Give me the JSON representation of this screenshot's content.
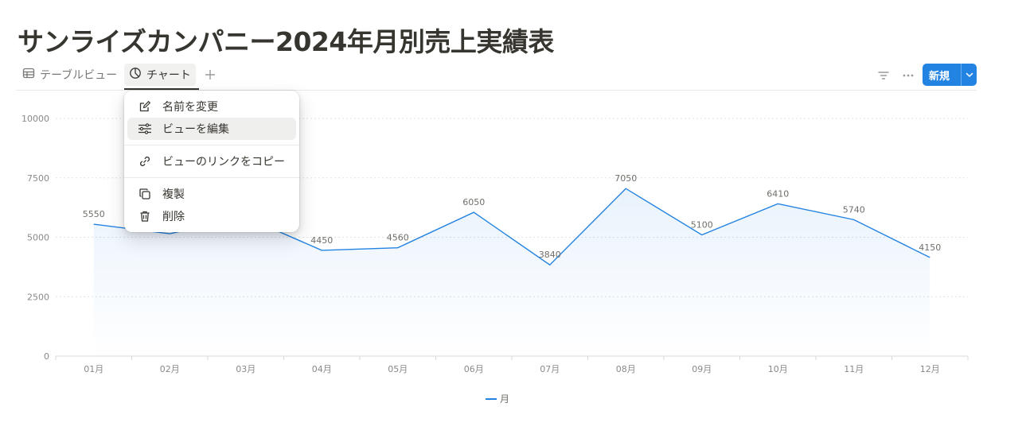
{
  "page": {
    "title": "サンライズカンパニー2024年月別売上実績表"
  },
  "views": {
    "tabs": [
      {
        "label": "テーブルビュー",
        "icon": "table-icon"
      },
      {
        "label": "チャート",
        "icon": "chart-pie-icon",
        "active": true
      }
    ],
    "add_icon": "plus-icon"
  },
  "toolbar": {
    "filter_icon": "filter-icon",
    "more_icon": "more-icon",
    "new_label": "新規",
    "new_dropdown_icon": "chevron-down-icon",
    "accent": "#2383e2"
  },
  "menu": {
    "items": [
      {
        "label": "名前を変更",
        "icon": "edit-icon"
      },
      {
        "label": "ビューを編集",
        "icon": "sliders-icon",
        "hovered": true
      },
      {
        "label": "ビューのリンクをコピー",
        "icon": "link-icon"
      },
      {
        "label": "複製",
        "icon": "duplicate-icon"
      },
      {
        "label": "削除",
        "icon": "trash-icon"
      }
    ]
  },
  "chart_data": {
    "type": "area",
    "categories": [
      "01月",
      "02月",
      "03月",
      "04月",
      "05月",
      "06月",
      "07月",
      "08月",
      "09月",
      "10月",
      "11月",
      "12月"
    ],
    "series": [
      {
        "name": "月",
        "values": [
          5550,
          5150,
          5850,
          4450,
          4560,
          6050,
          3840,
          7050,
          5100,
          6410,
          5740,
          4150
        ],
        "color": "#2383e2"
      }
    ],
    "data_labels": [
      "5550",
      "",
      "",
      "4450",
      "4560",
      "6050",
      "3840",
      "7050",
      "5100",
      "6410",
      "5740",
      "4150"
    ],
    "yticks": [
      "0",
      "2500",
      "5000",
      "7500",
      "10000"
    ],
    "ylim": [
      0,
      10000
    ],
    "grid": true,
    "legend_position": "bottom-center"
  }
}
